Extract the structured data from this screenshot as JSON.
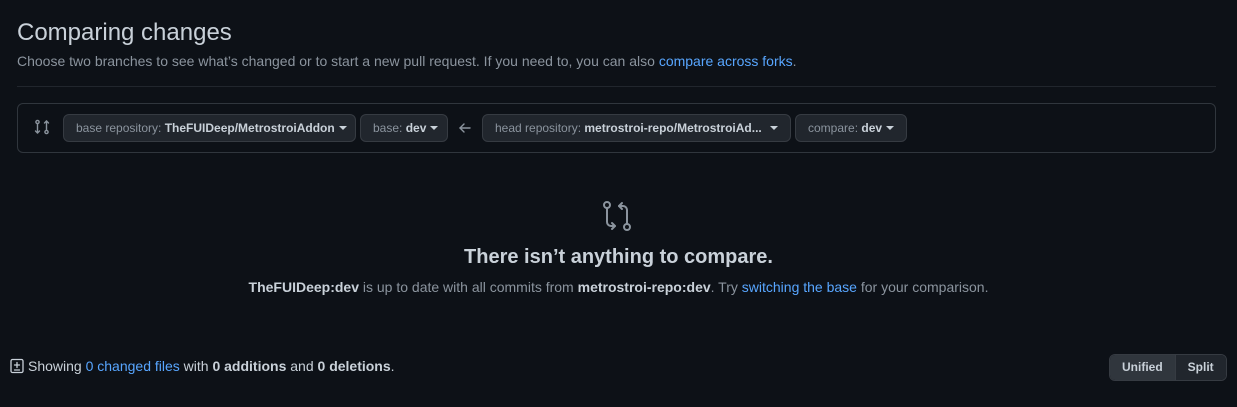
{
  "header": {
    "title": "Comparing changes",
    "subtitle_prefix": "Choose two branches to see what’s changed or to start a new pull request. If you need to, you can also ",
    "subtitle_link": "compare across forks",
    "subtitle_suffix": "."
  },
  "range_editor": {
    "base_repo_label": "base repository: ",
    "base_repo_value": "TheFUIDeep/MetrostroiAddon",
    "base_label": "base: ",
    "base_value": "dev",
    "head_repo_label": "head repository: ",
    "head_repo_value": "metrostroi-repo/MetrostroiAd...",
    "compare_label": "compare: ",
    "compare_value": "dev"
  },
  "blankslate": {
    "heading": "There isn’t anything to compare.",
    "base_ref": "TheFUIDeep:dev",
    "text_mid": " is up to date with all commits from ",
    "head_ref": "metrostroi-repo:dev",
    "text_try": ". Try ",
    "switch_link": "switching the base",
    "text_end": " for your comparison."
  },
  "toc": {
    "showing": "Showing ",
    "changed_files": "0 changed files",
    "with": " with ",
    "additions": "0 additions",
    "and": " and ",
    "deletions": "0 deletions",
    "period": "."
  },
  "view_toggle": {
    "unified": "Unified",
    "split": "Split",
    "selected": "Unified"
  },
  "colors": {
    "background": "#0d1117",
    "link": "#58a6ff",
    "muted": "#8b949e",
    "text": "#c9d1d9",
    "border": "#30363d"
  }
}
